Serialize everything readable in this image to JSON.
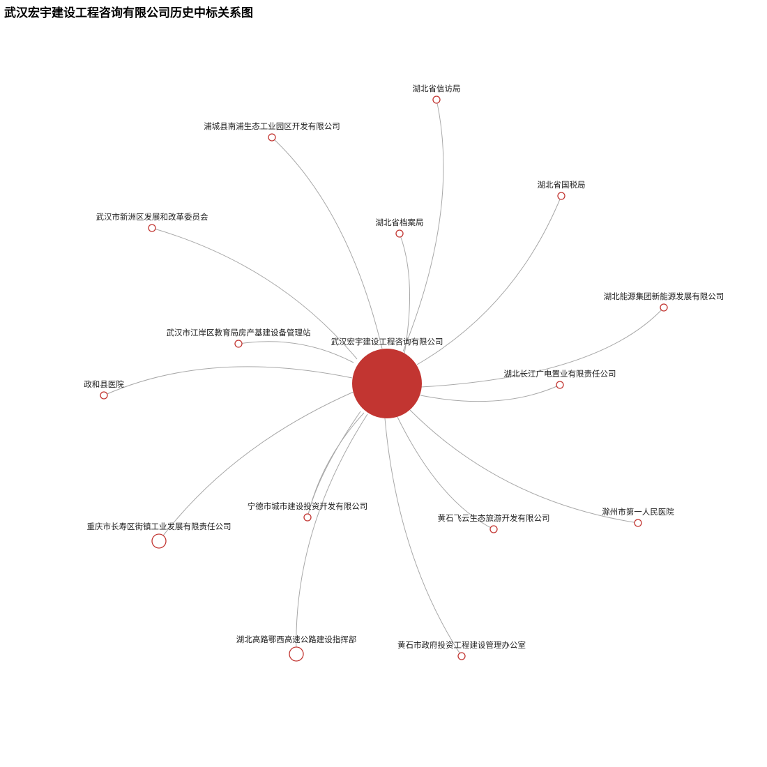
{
  "title": "武汉宏宇建设工程咨询有限公司历史中标关系图",
  "colors": {
    "node": "#c23531",
    "edge": "#a8a8a8"
  },
  "center": {
    "name": "武汉宏宇建设工程咨询有限公司"
  },
  "nodes": [
    {
      "id": "n1",
      "name": "湖北省信访局"
    },
    {
      "id": "n2",
      "name": "浦城县南浦生态工业园区开发有限公司"
    },
    {
      "id": "n3",
      "name": "湖北省国税局"
    },
    {
      "id": "n4",
      "name": "武汉市新洲区发展和改革委员会"
    },
    {
      "id": "n5",
      "name": "湖北省档案局"
    },
    {
      "id": "n6",
      "name": "湖北能源集团新能源发展有限公司"
    },
    {
      "id": "n7",
      "name": "武汉市江岸区教育局房产基建设备管理站"
    },
    {
      "id": "n8",
      "name": "湖北长江广电置业有限责任公司"
    },
    {
      "id": "n9",
      "name": "政和县医院"
    },
    {
      "id": "n10",
      "name": "滁州市第一人民医院"
    },
    {
      "id": "n11",
      "name": "宁德市城市建设投资开发有限公司"
    },
    {
      "id": "n12",
      "name": "黄石飞云生态旅游开发有限公司"
    },
    {
      "id": "n13",
      "name": "重庆市长寿区街镇工业发展有限责任公司"
    },
    {
      "id": "n14",
      "name": "湖北高路鄂西高速公路建设指挥部"
    },
    {
      "id": "n15",
      "name": "黄石市政府投资工程建设管理办公室"
    }
  ]
}
